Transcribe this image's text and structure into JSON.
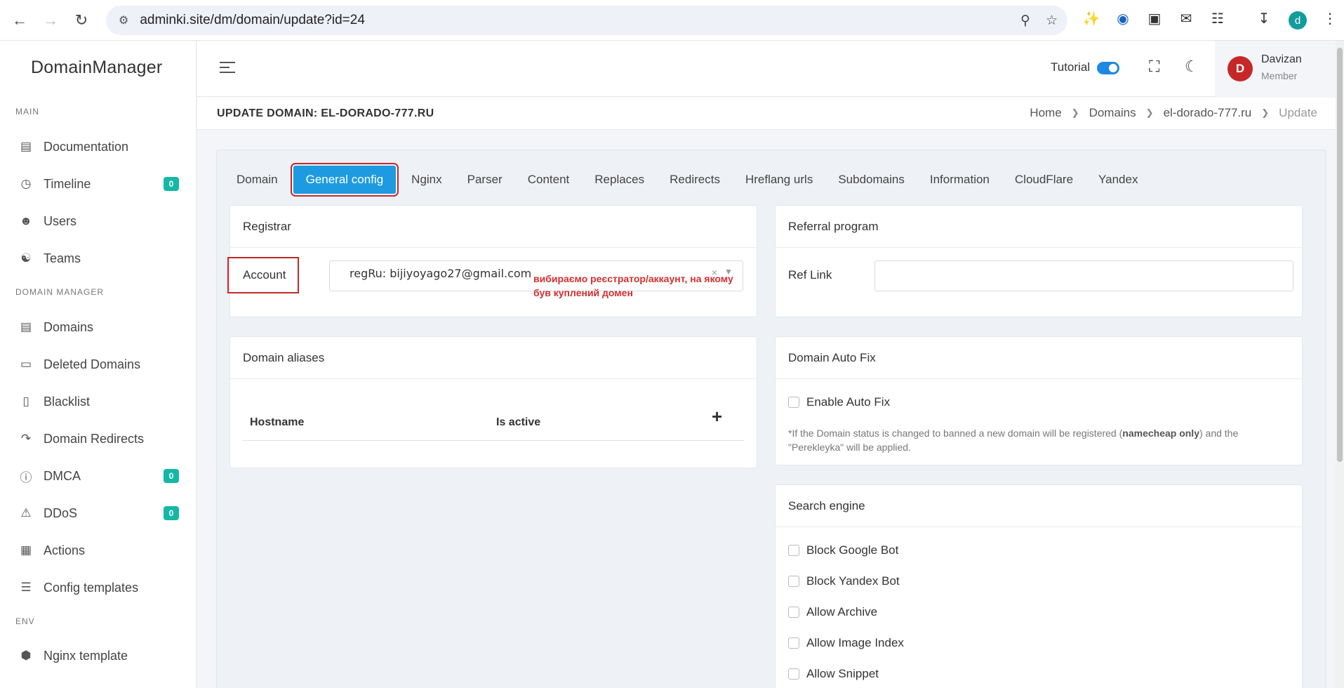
{
  "browser": {
    "url": "adminki.site/dm/domain/update?id=24",
    "profile_initial": "d"
  },
  "sidebar": {
    "brand": "DomainManager",
    "sections": [
      "MAIN",
      "DOMAIN MANAGER",
      "ENV"
    ],
    "items": [
      {
        "label": "Documentation",
        "icon": "document-icon"
      },
      {
        "label": "Timeline",
        "icon": "clock-icon",
        "badge": "0"
      },
      {
        "label": "Users",
        "icon": "user-icon"
      },
      {
        "label": "Teams",
        "icon": "team-icon"
      },
      {
        "label": "Domains",
        "icon": "domains-icon"
      },
      {
        "label": "Deleted Domains",
        "icon": "book-icon"
      },
      {
        "label": "Blacklist",
        "icon": "blacklist-icon"
      },
      {
        "label": "Domain Redirects",
        "icon": "redirect-icon"
      },
      {
        "label": "DMCA",
        "icon": "alert-circle-icon",
        "badge": "0"
      },
      {
        "label": "DDoS",
        "icon": "warning-icon",
        "badge": "0"
      },
      {
        "label": "Actions",
        "icon": "grid-icon"
      },
      {
        "label": "Config templates",
        "icon": "config-icon"
      },
      {
        "label": "Nginx template",
        "icon": "hexagon-icon"
      }
    ]
  },
  "header": {
    "tutorial_label": "Tutorial",
    "user_initial": "D",
    "user_name": "Davizan",
    "user_role": "Member"
  },
  "page": {
    "title": "UPDATE DOMAIN: EL-DORADO-777.RU",
    "breadcrumbs": [
      "Home",
      "Domains",
      "el-dorado-777.ru",
      "Update"
    ]
  },
  "tabs": [
    "Domain",
    "General config",
    "Nginx",
    "Parser",
    "Content",
    "Replaces",
    "Redirects",
    "Hreflang urls",
    "Subdomains",
    "Information",
    "CloudFlare",
    "Yandex"
  ],
  "registrar": {
    "title": "Registrar",
    "account_label": "Account",
    "account_value": "regRu: bijiyoyago27@gmail.com",
    "clear_glyph": "×",
    "annotation_line1": "вибираємо реєстратор/аккаунт, на якому",
    "annotation_line2": "був куплений домен"
  },
  "referral": {
    "title": "Referral program",
    "ref_link_label": "Ref Link",
    "ref_link_value": ""
  },
  "aliases": {
    "title": "Domain aliases",
    "col_hostname": "Hostname",
    "col_active": "Is active",
    "add_glyph": "+"
  },
  "autofix": {
    "title": "Domain Auto Fix",
    "checkbox_label": "Enable Auto Fix",
    "note_part1": "*If the Domain status is changed to banned a new domain will be registered (",
    "note_bold": "namecheap only",
    "note_part2": ") and the",
    "note_line2": "\"Perekleyka\" will be applied."
  },
  "search_engine": {
    "title": "Search engine",
    "options": [
      "Block Google Bot",
      "Block Yandex Bot",
      "Allow Archive",
      "Allow Image Index",
      "Allow Snippet"
    ]
  }
}
